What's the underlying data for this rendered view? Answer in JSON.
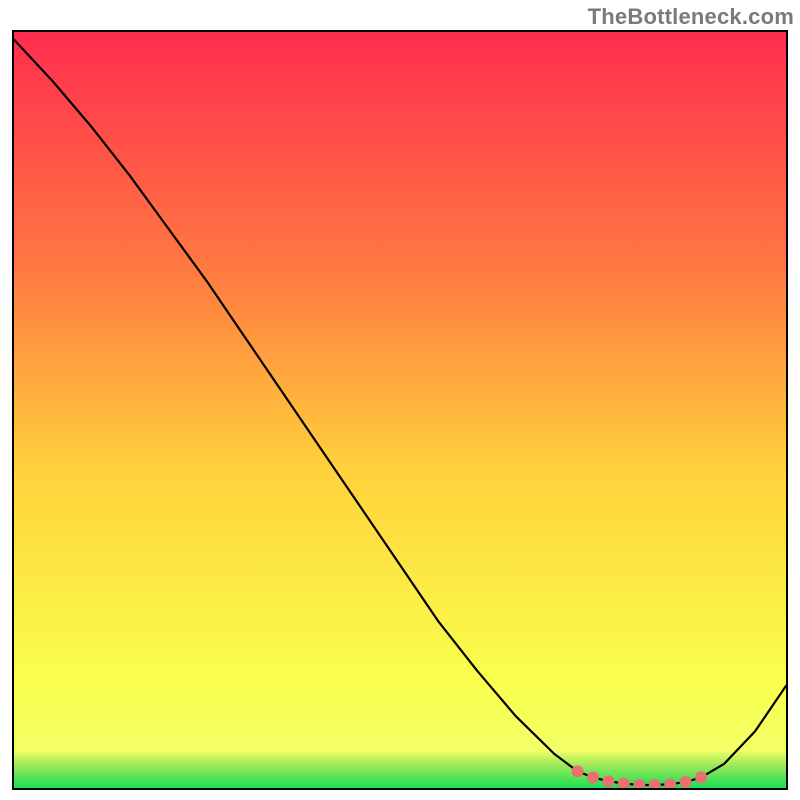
{
  "watermark": "TheBottleneck.com",
  "colors": {
    "gradient_top": "#ff2d4f",
    "gradient_mid1": "#ff7b40",
    "gradient_mid2": "#ffd23b",
    "gradient_mid3": "#f9ff4c",
    "gradient_bottom": "#19e055",
    "line": "#000000",
    "dot_fill": "#e8716f",
    "dot_stroke": "#e8716f",
    "frame": "#000000"
  },
  "chart_data": {
    "type": "line",
    "title": "",
    "xlabel": "",
    "ylabel": "",
    "xlim": [
      0,
      100
    ],
    "ylim": [
      0,
      100
    ],
    "x": [
      0,
      5,
      10,
      15,
      20,
      25,
      30,
      35,
      40,
      45,
      50,
      55,
      60,
      65,
      70,
      73,
      75,
      77,
      79,
      81,
      83,
      85,
      87,
      89,
      92,
      96,
      100
    ],
    "values": [
      99,
      93.5,
      87.5,
      81,
      74,
      67,
      59.5,
      52,
      44.5,
      37,
      29.5,
      22,
      15.5,
      9.5,
      4.5,
      2.2,
      1.4,
      0.9,
      0.6,
      0.4,
      0.4,
      0.5,
      0.8,
      1.4,
      3.2,
      7.5,
      13.5
    ],
    "highlight_x": [
      73,
      75,
      77,
      79,
      81,
      83,
      85,
      87,
      89
    ],
    "highlight_y": [
      2.2,
      1.4,
      0.9,
      0.6,
      0.4,
      0.4,
      0.5,
      0.8,
      1.4
    ],
    "gradient_bands": [
      {
        "y_top": 0.0,
        "y_bottom": 0.28
      },
      {
        "y_top": 0.28,
        "y_bottom": 0.52
      },
      {
        "y_top": 0.52,
        "y_bottom": 0.78
      },
      {
        "y_top": 0.78,
        "y_bottom": 0.94
      },
      {
        "y_top": 0.94,
        "y_bottom": 1.0
      }
    ]
  }
}
